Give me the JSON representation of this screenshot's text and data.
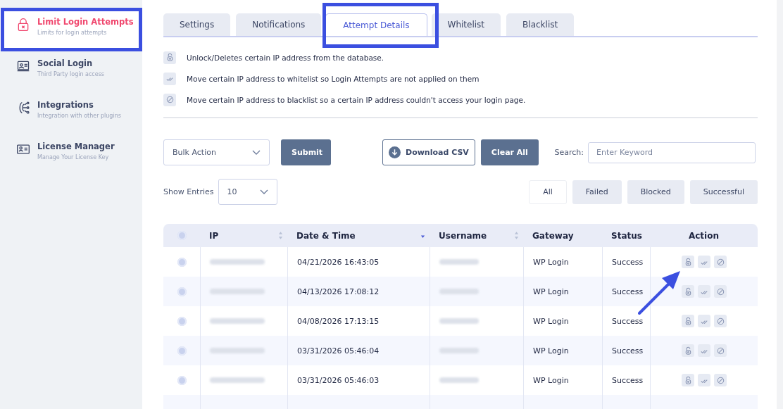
{
  "sidebar": {
    "items": [
      {
        "title": "Limit Login Attempts",
        "subtitle": "Limits for login attempts",
        "selected": true
      },
      {
        "title": "Social Login",
        "subtitle": "Third Party login access",
        "selected": false
      },
      {
        "title": "Integrations",
        "subtitle": "Integration with other plugins",
        "selected": false
      },
      {
        "title": "License Manager",
        "subtitle": "Manage Your License Key",
        "selected": false
      }
    ]
  },
  "tabs": [
    {
      "label": "Settings",
      "selected": false
    },
    {
      "label": "Notifications",
      "selected": false
    },
    {
      "label": "Attempt Details",
      "selected": true
    },
    {
      "label": "Whitelist",
      "selected": false
    },
    {
      "label": "Blacklist",
      "selected": false
    }
  ],
  "legend": [
    {
      "kind": "unlock",
      "text": "Unlock/Deletes certain IP address from the database."
    },
    {
      "kind": "whitelist",
      "text": "Move certain IP address to whitelist so Login Attempts are not applied on them"
    },
    {
      "kind": "blacklist",
      "text": "Move certain IP address to blacklist so a certain IP address couldn't access your login page."
    }
  ],
  "toolbar": {
    "bulk_action": "Bulk Action",
    "submit": "Submit",
    "download": "Download CSV",
    "clear": "Clear All",
    "search_label": "Search:",
    "search_placeholder": "Enter Keyword",
    "entries_label": "Show Entries",
    "entries_value": "10"
  },
  "filters": [
    {
      "label": "All",
      "selected": true
    },
    {
      "label": "Failed",
      "selected": false
    },
    {
      "label": "Blocked",
      "selected": false
    },
    {
      "label": "Successful",
      "selected": false
    }
  ],
  "table": {
    "all_selected": false,
    "columns": [
      {
        "label": "IP",
        "kind": "sortable"
      },
      {
        "label": "Date & Time",
        "kind": "sorted-desc"
      },
      {
        "label": "Username",
        "kind": "sortable"
      },
      {
        "label": "Gateway",
        "kind": "plain"
      },
      {
        "label": "Status",
        "kind": "plain"
      },
      {
        "label": "Action",
        "kind": "plain"
      }
    ],
    "rows": [
      {
        "selected": false,
        "date": "04/21/2026 16:43:05",
        "gateway": "WP Login",
        "status": "Success"
      },
      {
        "selected": false,
        "date": "04/13/2026 17:08:12",
        "gateway": "WP Login",
        "status": "Success"
      },
      {
        "selected": false,
        "date": "04/08/2026 17:13:15",
        "gateway": "WP Login",
        "status": "Success"
      },
      {
        "selected": false,
        "date": "03/31/2026 05:46:04",
        "gateway": "WP Login",
        "status": "Success"
      },
      {
        "selected": false,
        "date": "03/31/2026 05:46:03",
        "gateway": "WP Login",
        "status": "Success"
      }
    ]
  }
}
